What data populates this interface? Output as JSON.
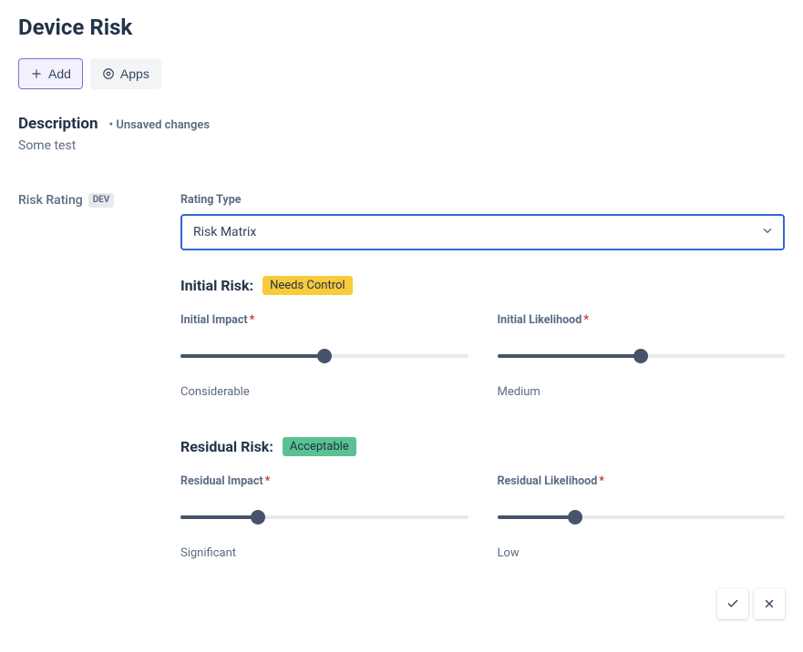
{
  "title": "Device Risk",
  "buttons": {
    "add": "Add",
    "apps": "Apps"
  },
  "description": {
    "label": "Description",
    "unsaved": "• Unsaved changes",
    "text": "Some test"
  },
  "riskRating": {
    "label": "Risk Rating",
    "badge": "DEV"
  },
  "ratingType": {
    "label": "Rating Type",
    "value": "Risk Matrix"
  },
  "initial": {
    "heading": "Initial Risk:",
    "pill": "Needs Control",
    "impact": {
      "label": "Initial Impact",
      "value": "Considerable",
      "pct": 50
    },
    "likelihood": {
      "label": "Initial Likelihood",
      "value": "Medium",
      "pct": 50
    }
  },
  "residual": {
    "heading": "Residual Risk:",
    "pill": "Acceptable",
    "impact": {
      "label": "Residual Impact",
      "value": "Significant",
      "pct": 27
    },
    "likelihood": {
      "label": "Residual Likelihood",
      "value": "Low",
      "pct": 27
    }
  }
}
